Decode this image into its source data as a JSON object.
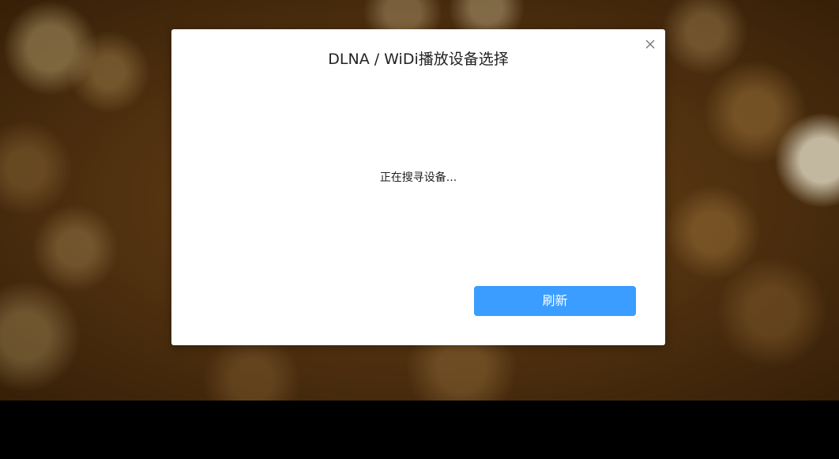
{
  "dialog": {
    "title": "DLNA / WiDi播放设备选择",
    "close_icon": "close-icon",
    "status_text": "正在搜寻设备...",
    "refresh_label": "刷新"
  },
  "colors": {
    "primary_button": "#3a9dff",
    "dialog_background": "#ffffff",
    "bottom_bar": "#000000"
  }
}
